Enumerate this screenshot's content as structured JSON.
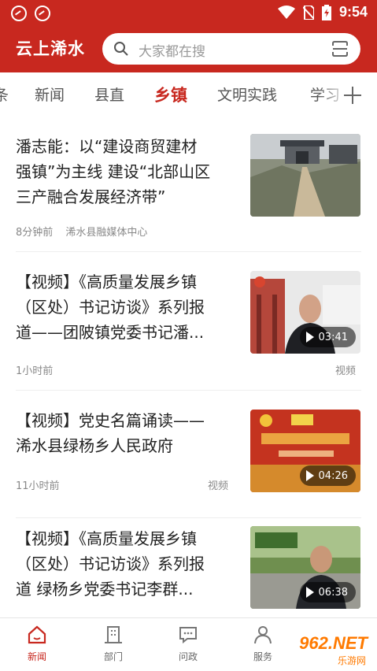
{
  "status_bar": {
    "time": "9:54",
    "icons": [
      "app-icon",
      "app-icon",
      "wifi-icon",
      "no-sim-icon",
      "battery-icon"
    ]
  },
  "header": {
    "app_title": "云上浠水",
    "search_placeholder": "大家都在搜",
    "accent_color": "#c8281f"
  },
  "tabs": [
    {
      "label": "条"
    },
    {
      "label": "新闻"
    },
    {
      "label": "县直"
    },
    {
      "label": "乡镇",
      "active": true
    },
    {
      "label": "文明实践"
    },
    {
      "label": "学习"
    }
  ],
  "articles": [
    {
      "title_lines": [
        "潘志能：以“建设商贸建材",
        "强镇”为主线 建设“北部山区",
        "三产融合发展经济带”"
      ],
      "time": "8分钟前",
      "source": "浠水县融媒体中心",
      "tag": "",
      "duration": ""
    },
    {
      "title_lines": [
        "【视频】《高质量发展乡镇",
        "（区处）书记访谈》系列报",
        "道——团陂镇党委书记潘..."
      ],
      "time": "1小时前",
      "source": "",
      "tag": "视频",
      "duration": "03:41"
    },
    {
      "title_lines": [
        "【视频】党史名篇诵读——",
        "浠水县绿杨乡人民政府"
      ],
      "time": "11小时前",
      "source": "",
      "tag": "视频",
      "duration": "04:26"
    },
    {
      "title_lines": [
        "【视频】《高质量发展乡镇",
        "（区处）书记访谈》系列报",
        "道 绿杨乡党委书记李群..."
      ],
      "time": "",
      "source": "",
      "tag": "",
      "duration": "06:38"
    }
  ],
  "bottom_nav": [
    {
      "label": "新闻",
      "icon": "home-icon",
      "active": true
    },
    {
      "label": "部门",
      "icon": "building-icon"
    },
    {
      "label": "问政",
      "icon": "chat-icon"
    },
    {
      "label": "服务",
      "icon": "person-icon"
    }
  ],
  "watermark": {
    "brand": "962.NET",
    "sub": "乐游网"
  }
}
